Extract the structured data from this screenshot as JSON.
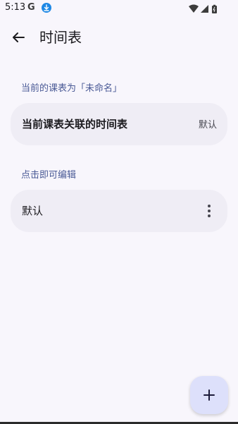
{
  "status_bar": {
    "time": "5:13",
    "google_glyph": "G"
  },
  "app_bar": {
    "title": "时间表"
  },
  "section_current": {
    "header": "当前的课表为「未命名」",
    "card_title": "当前课表关联的时间表",
    "card_value": "默认"
  },
  "section_edit": {
    "header": "点击即可编辑",
    "items": [
      {
        "label": "默认"
      }
    ]
  },
  "colors": {
    "background": "#f8f6fc",
    "card": "#efedf5",
    "section_header": "#4a5a96",
    "fab": "#dde0fb"
  }
}
